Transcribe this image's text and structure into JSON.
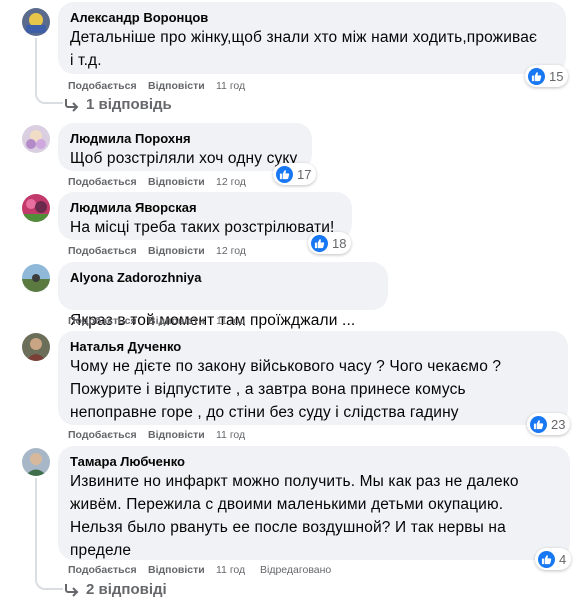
{
  "actions": {
    "like_label": "Подобається",
    "reply_label": "Відповісти"
  },
  "comments": [
    {
      "author": "Александр Воронцов",
      "text": "Детальніше про жінку,щоб знали хто між нами ходить,проживає\nі т.д.",
      "time": "11 год",
      "reactions": "15",
      "replies_label": "1 відповідь"
    },
    {
      "author": "Людмила Порохня",
      "text": "Щоб розстріляли хоч одну суку",
      "time": "12 год",
      "reactions": "17"
    },
    {
      "author": "Людмила Яворская",
      "text": "На місці треба таких розстрілювати!",
      "time": "12 год",
      "reactions": "18"
    },
    {
      "author": "Alyona Zadorozhniya",
      "text": "Якраз в той момент там проїжджали ...",
      "time": "11 год",
      "emoji": "grinning-sweat-emoji"
    },
    {
      "author": "Наталья Дученко",
      "text": "Чому не дієте по закону військового часу ? Чого чекаємо ?\nПожурите і відпустите , а завтра вона принесе комусь\nнепоправне горе , до стіни без суду і слідства гадину",
      "time": "11 год",
      "reactions": "23"
    },
    {
      "author": "Тамара Любченко",
      "text": "Извините но инфаркт можно получить. Мы как раз не далеко\nживём. Пережила с двоими маленькими детьми окупацию.\nНельзя было рвануть ее после воздушной? И так нервы на\nпределе",
      "time": "11 год",
      "edited": "Відредаговано",
      "reactions": "4",
      "replies_label": "2 відповіді"
    }
  ],
  "colors": {
    "bubble_bg": "#f0f2f5",
    "like_blue": "#1877f2",
    "meta_gray": "#65676b"
  }
}
